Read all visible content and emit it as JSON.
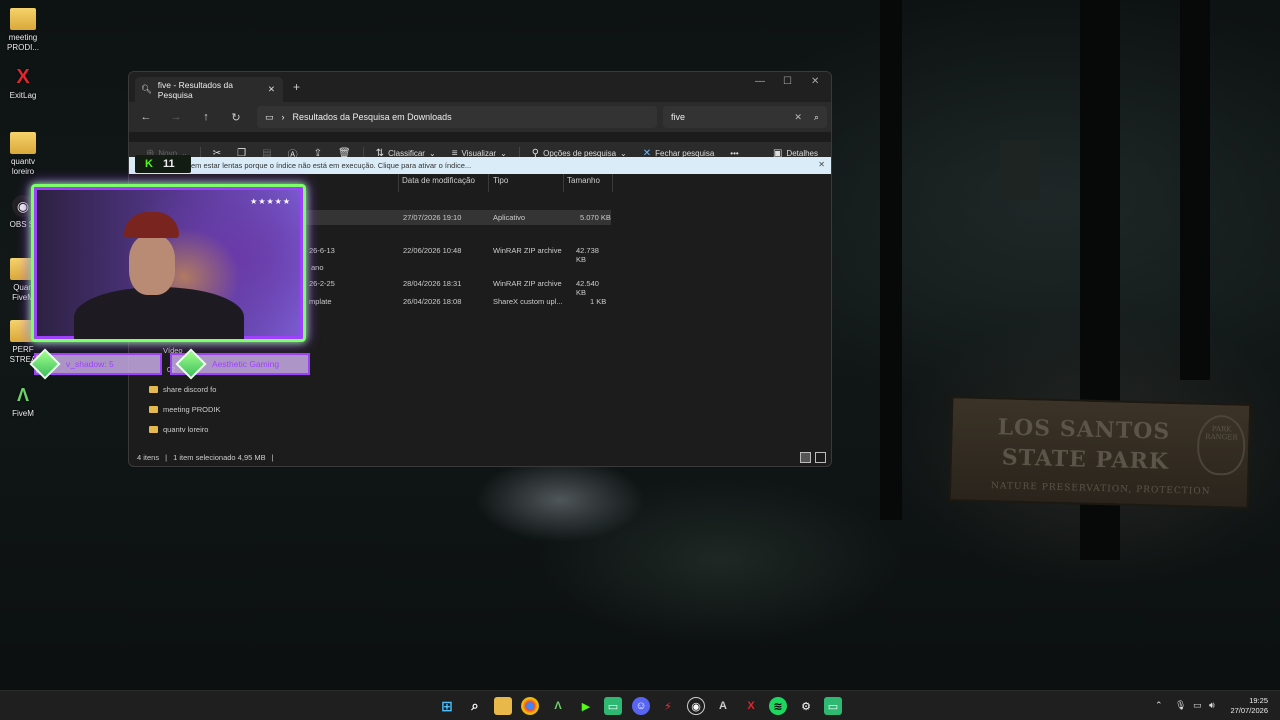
{
  "desktop": {
    "icons": [
      {
        "label": "meeting PRODI...",
        "glyph": "",
        "type": "folder"
      },
      {
        "label": "ExitLag",
        "glyph": "X",
        "type": "app"
      },
      {
        "label": "quantv loreiro",
        "glyph": "",
        "type": "folder"
      },
      {
        "label": "OBS St",
        "glyph": "◉",
        "type": "app"
      },
      {
        "label": "Quan FiveM",
        "glyph": "",
        "type": "folder"
      },
      {
        "label": "PERF STREA",
        "glyph": "",
        "type": "folder"
      },
      {
        "label": "FiveM",
        "glyph": "Λ",
        "type": "app"
      }
    ],
    "sign": {
      "line1": "LOS SANTOS",
      "line2": "STATE PARK",
      "line3": "NATURE PRESERVATION, PROTECTION",
      "badge": "PARK RANGER"
    }
  },
  "explorer": {
    "tab_title": "five - Resultados da Pesquisa",
    "address": "Resultados da Pesquisa em Downloads",
    "search_value": "five",
    "toolbar": {
      "new": "Novo",
      "sort": "Classificar",
      "view": "Visualizar",
      "search_options": "Opções de pesquisa",
      "close_search": "Fechar pesquisa",
      "more": "•••",
      "details": "Detalhes"
    },
    "info_bar": "em estar lentas porque o índice não está em execução. Clique para ativar o índice...",
    "columns": {
      "date": "Data de modificação",
      "type": "Tipo",
      "size": "Tamanho"
    },
    "rows": [
      {
        "name": "",
        "date": "27/07/2026 19:10",
        "type": "Aplicativo",
        "size": "5.070 KB"
      },
      {
        "name": "26-6-13",
        "date": "22/06/2026 10:48",
        "type": "WinRAR ZIP archive",
        "size": "42.738 KB"
      },
      {
        "name": "26-2-25",
        "date": "28/04/2026 18:31",
        "type": "WinRAR ZIP archive",
        "size": "42.540 KB"
      },
      {
        "name": "mplate",
        "date": "26/04/2026 18:08",
        "type": "ShareX custom upl...",
        "size": "1 KB"
      }
    ],
    "group_ano": "ano",
    "sidebar": [
      {
        "label": "Vídeo"
      },
      {
        "label": "02"
      },
      {
        "label": "share discord fo"
      },
      {
        "label": "meeting PRODIK"
      },
      {
        "label": "quantv loreiro"
      }
    ],
    "status": {
      "items": "4 itens",
      "selected": "1 item selecionado  4,95 MB"
    }
  },
  "overlay": {
    "stars": "★★★★★",
    "kick_count": "11",
    "follower1": "v_shadow: 5",
    "follower2": "Aesthetic Gaming"
  },
  "taskbar": {
    "time": "19:25",
    "date": "27/07/2026"
  }
}
